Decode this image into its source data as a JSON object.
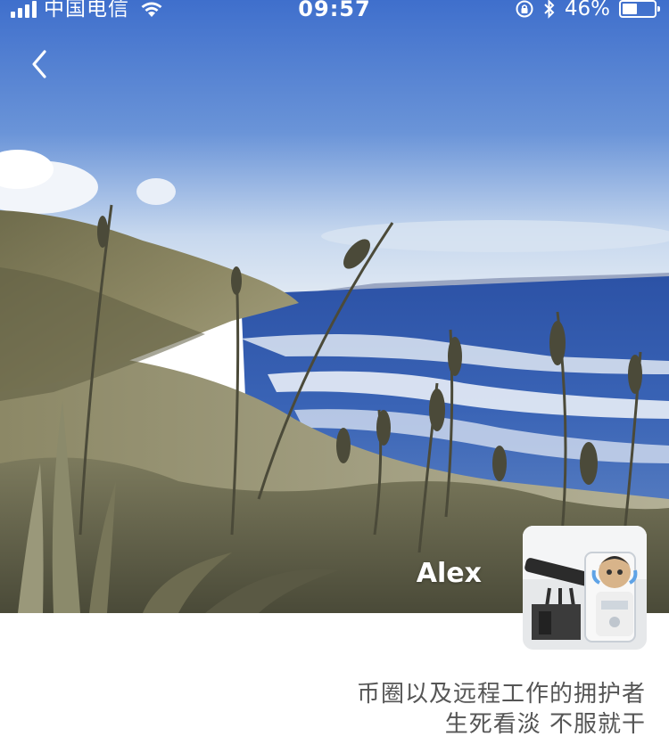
{
  "status_bar": {
    "carrier": "中国电信",
    "time": "09:57",
    "battery_percent_text": "46%",
    "battery_level": 0.46,
    "icons": [
      "signal-icon",
      "wifi-icon",
      "rotation-lock-icon",
      "bluetooth-icon",
      "battery-icon"
    ]
  },
  "header": {
    "back_icon": "chevron-left-icon"
  },
  "profile": {
    "name": "Alex",
    "bio_lines": [
      "币圈以及远程工作的拥护者",
      "生死看淡 不服就干"
    ]
  },
  "colors": {
    "status_text": "#ffffff",
    "bio_text": "#555555",
    "sky_top": "#4a77cf",
    "sea": "#2d55a8"
  }
}
